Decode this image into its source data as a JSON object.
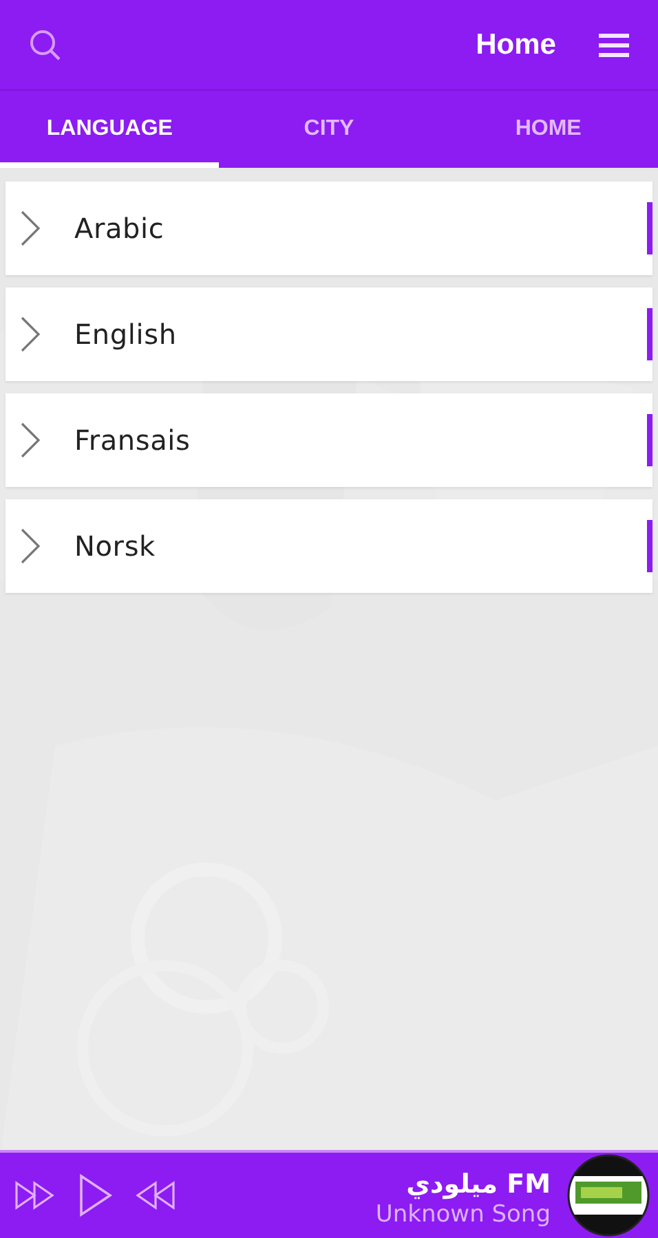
{
  "header": {
    "title": "Home"
  },
  "tabs": [
    {
      "label": "LANGUAGE",
      "selected": true
    },
    {
      "label": "CITY",
      "selected": false
    },
    {
      "label": "HOME",
      "selected": false
    }
  ],
  "languages": [
    {
      "name": "Arabic"
    },
    {
      "name": "English"
    },
    {
      "name": "Fransais"
    },
    {
      "name": "Norsk"
    }
  ],
  "player": {
    "station": "ميلودي FM",
    "song": "Unknown Song",
    "playing": false
  }
}
